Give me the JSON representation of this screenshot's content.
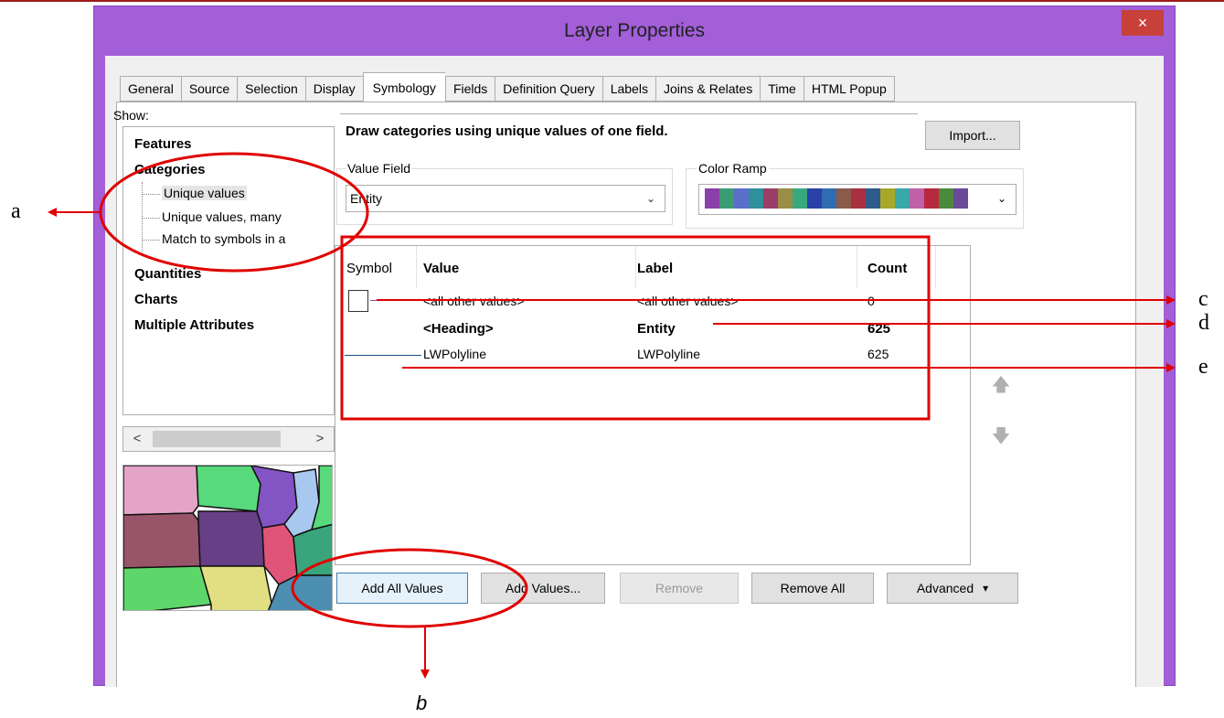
{
  "window": {
    "title": "Layer Properties",
    "close_glyph": "×"
  },
  "tabs": [
    {
      "label": "General"
    },
    {
      "label": "Source"
    },
    {
      "label": "Selection"
    },
    {
      "label": "Display"
    },
    {
      "label": "Symbology",
      "active": true
    },
    {
      "label": "Fields"
    },
    {
      "label": "Definition Query"
    },
    {
      "label": "Labels"
    },
    {
      "label": "Joins & Relates"
    },
    {
      "label": "Time"
    },
    {
      "label": "HTML Popup"
    }
  ],
  "show": {
    "label": "Show:",
    "items": [
      "Features",
      "Categories",
      "Quantities",
      "Charts",
      "Multiple Attributes"
    ],
    "subitems": [
      "Unique values",
      "Unique values, many",
      "Match to symbols in a"
    ],
    "scroll_left": "<",
    "scroll_right": ">"
  },
  "symbology": {
    "description": "Draw categories using unique values of one field.",
    "import_label": "Import...",
    "value_field_label": "Value Field",
    "value_field_value": "Entity",
    "color_ramp_label": "Color Ramp",
    "color_ramp_colors": [
      "#8b3fa8",
      "#3b9c74",
      "#5b6ec9",
      "#2f8f9a",
      "#9a3e68",
      "#9a8d47",
      "#3aa87e",
      "#2a41a8",
      "#2f6db0",
      "#8a5a4a",
      "#a83040",
      "#2e5a8c",
      "#a7a82a",
      "#38a8a8",
      "#c060a8",
      "#b8283e",
      "#4a8a3a",
      "#6a4a9a"
    ]
  },
  "table": {
    "headers": {
      "symbol": "Symbol",
      "value": "Value",
      "label": "Label",
      "count": "Count"
    },
    "rows": [
      {
        "value": "<all other values>",
        "label": "<all other values>",
        "count": "0"
      },
      {
        "value": "<Heading>",
        "label": "Entity",
        "count": "625"
      },
      {
        "value": "LWPolyline",
        "label": "LWPolyline",
        "count": "625"
      }
    ]
  },
  "buttons": {
    "add_all": "Add All Values",
    "add_values": "Add Values...",
    "remove": "Remove",
    "remove_all": "Remove All",
    "advanced": "Advanced",
    "advanced_arrow": "▾",
    "move_up": "🡅",
    "move_down": "🡇"
  },
  "annotations": {
    "a": "a",
    "b": "b",
    "c": "c",
    "d": "d",
    "e": "e",
    "annotation_color": "#e00000"
  }
}
